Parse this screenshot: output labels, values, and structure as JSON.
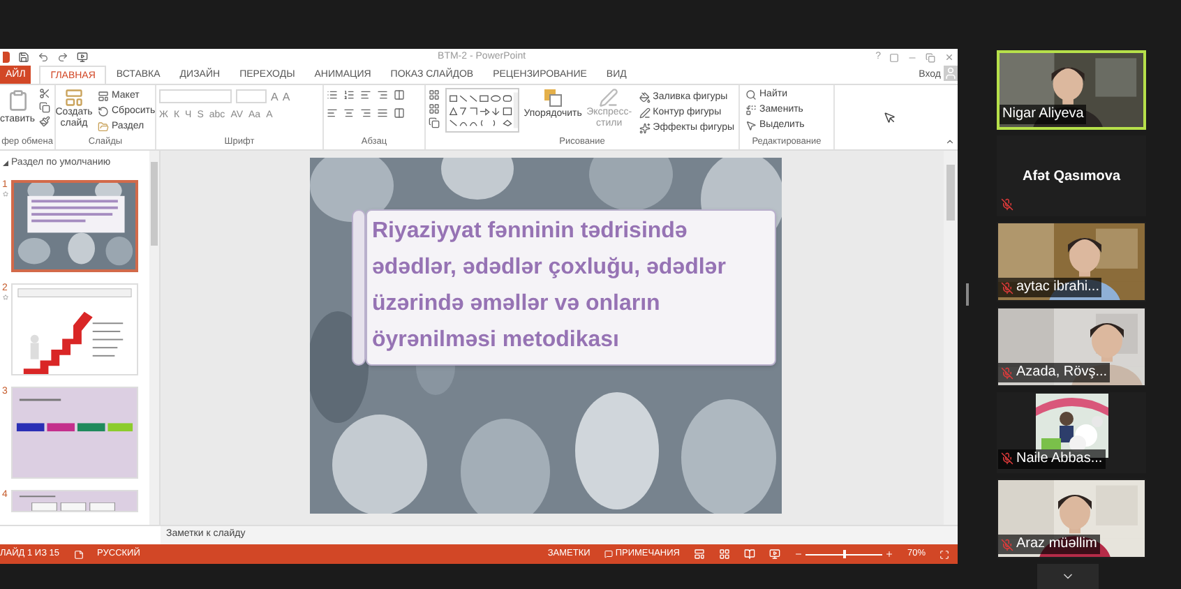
{
  "window": {
    "title": "BTM-2 - PowerPoint",
    "help": "?",
    "sign_in": "Вход"
  },
  "tabs": [
    {
      "label": "АЙЛ",
      "kind": "file",
      "selected": false
    },
    {
      "label": "ГЛАВНАЯ",
      "kind": "tab",
      "selected": true
    },
    {
      "label": "ВСТАВКА",
      "kind": "tab",
      "selected": false
    },
    {
      "label": "ДИЗАЙН",
      "kind": "tab",
      "selected": false
    },
    {
      "label": "ПЕРЕХОДЫ",
      "kind": "tab",
      "selected": false
    },
    {
      "label": "АНИМАЦИЯ",
      "kind": "tab",
      "selected": false
    },
    {
      "label": "ПОКАЗ СЛАЙДОВ",
      "kind": "tab",
      "selected": false
    },
    {
      "label": "РЕЦЕНЗИРОВАНИЕ",
      "kind": "tab",
      "selected": false
    },
    {
      "label": "ВИД",
      "kind": "tab",
      "selected": false
    }
  ],
  "ribbon": [
    {
      "label": "фер обмена",
      "kind": "clipboard",
      "buttons": [
        {
          "label": "ставить"
        }
      ]
    },
    {
      "label": "Слайды",
      "kind": "slides",
      "buttons": [
        {
          "label": "Создать слайд"
        },
        {
          "label": "Макет"
        },
        {
          "label": "Сбросить"
        },
        {
          "label": "Раздел"
        }
      ]
    },
    {
      "label": "Шрифт",
      "kind": "font",
      "buttons": [
        {
          "label": "A"
        },
        {
          "label": "A"
        },
        {
          "label": "Ж"
        },
        {
          "label": "К"
        },
        {
          "label": "Ч"
        },
        {
          "label": "S"
        },
        {
          "label": "abc"
        },
        {
          "label": "AV"
        },
        {
          "label": "Aa"
        },
        {
          "label": "A"
        }
      ]
    },
    {
      "label": "Абзац",
      "kind": "paragraph"
    },
    {
      "label": "Рисование",
      "kind": "drawing",
      "buttons": [
        {
          "label": "Упорядочить"
        },
        {
          "label": "Экспресс-стили"
        },
        {
          "label": "Заливка фигуры"
        },
        {
          "label": "Контур фигуры"
        },
        {
          "label": "Эффекты фигуры"
        }
      ]
    },
    {
      "label": "Редактирование",
      "kind": "editing",
      "buttons": [
        {
          "label": "Найти"
        },
        {
          "label": "Заменить"
        },
        {
          "label": "Выделить"
        }
      ]
    }
  ],
  "slide_panel": {
    "section": "Раздел по умолчанию",
    "slides": [
      {
        "number": "1",
        "kind": "title",
        "selected": true
      },
      {
        "number": "2",
        "kind": "stairs",
        "selected": false
      },
      {
        "number": "3",
        "kind": "swatches",
        "selected": false
      },
      {
        "number": "4",
        "kind": "buttons",
        "selected": false
      }
    ]
  },
  "slide": {
    "title": "Riyaziyyat fənninin tədrisində ədədlər, ədədlər çoxluğu, ədədlər üzərində əməllər və onların öyrənilməsi metodikası"
  },
  "notes": {
    "placeholder": "Заметки к слайду"
  },
  "status_bar": {
    "slide": "ЛАЙД 1 ИЗ 15",
    "language": "РУССКИЙ",
    "notes": "ЗАМЕТКИ",
    "comments": "ПРИМЕЧАНИЯ",
    "zoom": "70%",
    "zoom_slider": {
      "level": 0.5
    }
  },
  "participants": [
    {
      "name": "Nigar Aliyeva",
      "kind": "video",
      "speaking": true,
      "muted": false
    },
    {
      "name": "Afət Qasımova",
      "kind": "name_only",
      "speaking": false,
      "muted": true
    },
    {
      "name": "aytac ibrahi...",
      "kind": "video",
      "speaking": false,
      "muted": true
    },
    {
      "name": "Azada, Rövş...",
      "kind": "video",
      "speaking": false,
      "muted": true
    },
    {
      "name": "Naile Abbas...",
      "speaking": false,
      "muted": true
    },
    {
      "name": "Araz müəllim",
      "kind": "video",
      "speaking": false,
      "muted": true
    }
  ]
}
